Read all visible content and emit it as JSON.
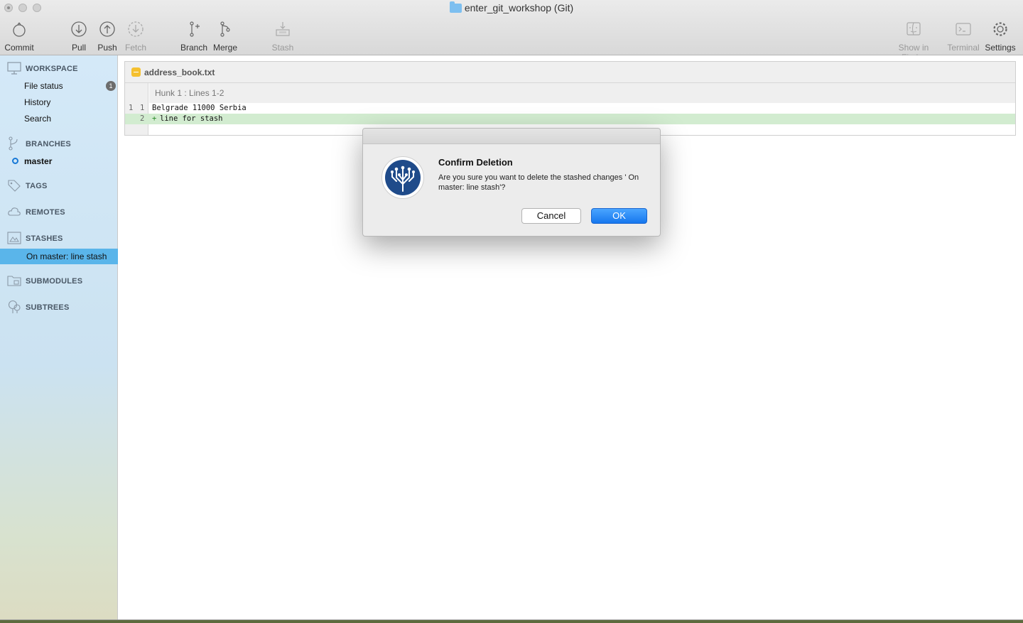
{
  "window": {
    "title": "enter_git_workshop (Git)"
  },
  "toolbar": {
    "commit": "Commit",
    "pull": "Pull",
    "push": "Push",
    "fetch": "Fetch",
    "branch": "Branch",
    "merge": "Merge",
    "stash": "Stash",
    "show_in_finder": "Show in Finder",
    "terminal": "Terminal",
    "settings": "Settings"
  },
  "sidebar": {
    "workspace": {
      "header": "WORKSPACE",
      "items": [
        {
          "label": "File status",
          "badge": "1"
        },
        {
          "label": "History"
        },
        {
          "label": "Search"
        }
      ]
    },
    "branches": {
      "header": "BRANCHES",
      "current": "master"
    },
    "tags": {
      "header": "TAGS"
    },
    "remotes": {
      "header": "REMOTES"
    },
    "stashes": {
      "header": "STASHES",
      "selected": "On master: line stash"
    },
    "submodules": {
      "header": "SUBMODULES"
    },
    "subtrees": {
      "header": "SUBTREES"
    }
  },
  "diff": {
    "file_name": "address_book.txt",
    "hunk_label": "Hunk 1 : Lines 1-2",
    "lines": [
      {
        "old": "1",
        "new": "1",
        "marker": "",
        "text": "Belgrade 11000 Serbia"
      },
      {
        "old": "",
        "new": "2",
        "marker": "+",
        "text": "line for stash"
      }
    ]
  },
  "dialog": {
    "title": "Confirm Deletion",
    "message": "Are you sure you want to delete the stashed changes ' On master: line stash'?",
    "cancel": "Cancel",
    "ok": "OK"
  },
  "colors": {
    "accent": "#1677ee",
    "selection": "#5ab5ea",
    "added_line": "#d2ecd0",
    "file_icon": "#f5c02f"
  }
}
